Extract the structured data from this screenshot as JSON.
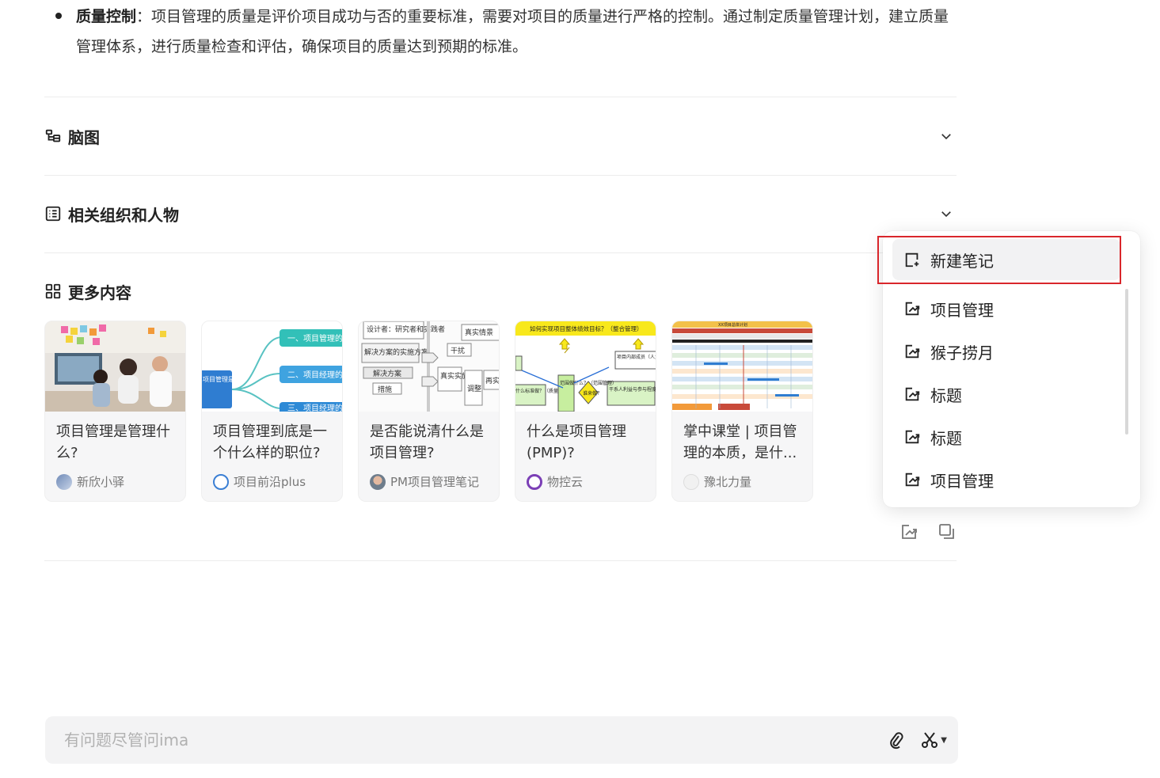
{
  "bullet": {
    "label": "质量控制",
    "text": "：项目管理的质量是评价项目成功与否的重要标准，需要对项目的质量进行严格的控制。通过制定质量管理计划，建立质量管理体系，进行质量检查和评估，确保项目的质量达到预期的标准。"
  },
  "sections": {
    "mindmap": {
      "title": "脑图",
      "icon": "mindmap-icon"
    },
    "related": {
      "title": "相关组织和人物",
      "icon": "list-icon"
    },
    "more": {
      "title": "更多内容",
      "icon": "grid-icon"
    }
  },
  "cards": [
    {
      "title": "项目管理是管理什么?",
      "source": "新欣小驿"
    },
    {
      "title": "项目管理到底是一个什么样的职位?",
      "source": "项目前沿plus"
    },
    {
      "title": "是否能说清什么是项目管理?",
      "source": "PM项目管理笔记"
    },
    {
      "title": "什么是项目管理(PMP)?",
      "source": "物控云"
    },
    {
      "title": "掌中课堂 | 项目管理的本质，是什...",
      "source": "豫北力量"
    }
  ],
  "thumbs": {
    "mindmap_labels": [
      "一、项目管理的",
      "二、项目经理的",
      "三、项目经理的",
      "项目管理是一个什么样职位?"
    ],
    "flow_labels": [
      "设计者：研究者和实践者",
      "解决方案的实施方案",
      "解决方案",
      "措施",
      "干扰",
      "真实情景",
      "真实实施",
      "调整",
      "再实"
    ],
    "pmp_title": "如何实现项目整体绩效目标？（整合管理）",
    "pmp_labels": [
      "项目内部成员（人力资源管理）",
      "干系人利益与参与程度（干系人管理）",
      "什么标准做？（质量管理）",
      "范围做什么？（范围管理）",
      "谁来做？"
    ],
    "gantt_title": "XX项目总体计划"
  },
  "menu": {
    "items": [
      {
        "label": "新建笔记",
        "icon": "new-note-icon"
      },
      {
        "label": "项目管理",
        "icon": "edit-note-icon"
      },
      {
        "label": "猴子捞月",
        "icon": "edit-note-icon"
      },
      {
        "label": "标题",
        "icon": "edit-note-icon"
      },
      {
        "label": "标题",
        "icon": "edit-note-icon"
      },
      {
        "label": "项目管理",
        "icon": "edit-note-icon"
      }
    ]
  },
  "ask": {
    "placeholder": "有问题尽管问ima"
  },
  "colors": {
    "highlight": "#d9262b",
    "card_bg": "#f6f6f7",
    "input_bg": "#f3f3f4"
  }
}
